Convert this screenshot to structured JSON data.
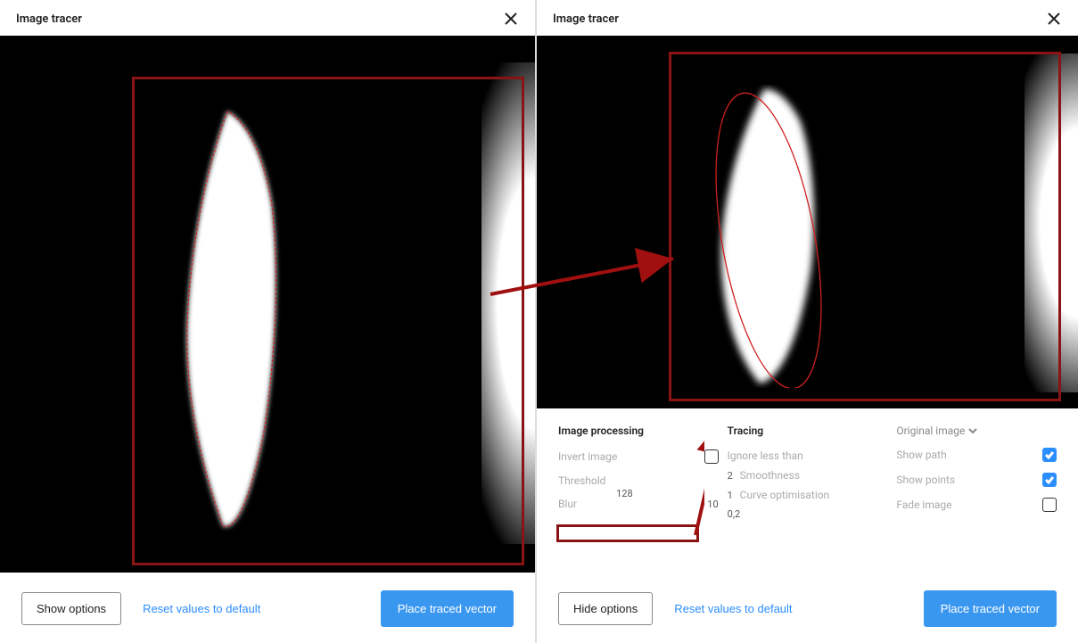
{
  "left": {
    "title": "Image tracer",
    "footer": {
      "toggle": "Show options",
      "reset": "Reset values to default",
      "place": "Place traced vector"
    }
  },
  "right": {
    "title": "Image tracer",
    "options": {
      "imageProcessing": {
        "heading": "Image processing",
        "invert": "Invert image",
        "invertChecked": false,
        "threshold": "Threshold",
        "thresholdValue": "128",
        "blur": "Blur",
        "blurValue": "10"
      },
      "tracing": {
        "heading": "Tracing",
        "ignore": "Ignore less than",
        "ignoreValue": "2",
        "smooth": "Smoothness",
        "smoothValue": "1",
        "curve": "Curve optimisation",
        "curveValue": "0,2"
      },
      "display": {
        "originalImage": "Original image",
        "showPath": "Show path",
        "showPathChecked": true,
        "showPoints": "Show points",
        "showPointsChecked": true,
        "fadeImage": "Fade image",
        "fadeImageChecked": false
      }
    },
    "footer": {
      "toggle": "Hide options",
      "reset": "Reset values to default",
      "place": "Place traced vector"
    }
  }
}
